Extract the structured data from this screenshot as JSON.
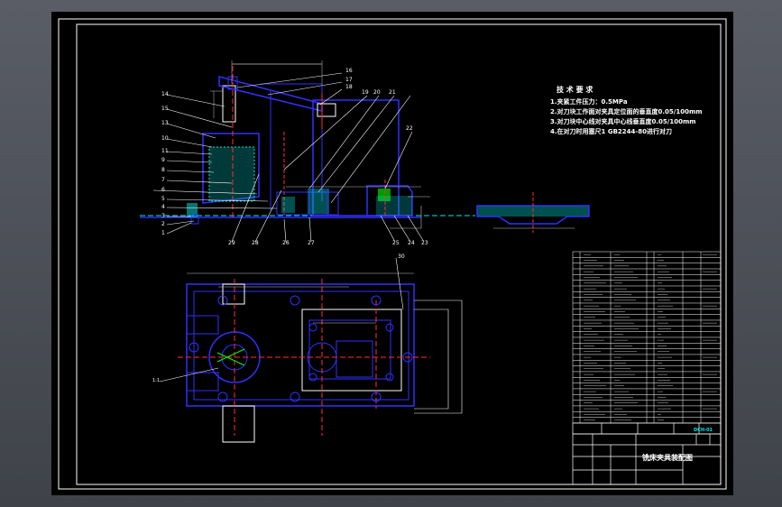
{
  "drawing": {
    "colors": {
      "background": "#000000",
      "outline": "#ffffff",
      "part": "#3030ff",
      "center": "#ff3030",
      "hatch": "#00e5e5",
      "dim": "#bfbfbf",
      "accent": "#ffff00",
      "green": "#00ff00"
    },
    "tech_title": "技 术 要 求",
    "tech_notes": [
      "1.夹紧工件压力：0.5MPa",
      "2.对刀块工作面对夹具定位面的垂直度0.05/100mm",
      "3.对刀块中心线对夹具中心线垂直度0.05/100mm",
      "4.在对刀时用塞尺1 GB2244-80进行对刀"
    ],
    "balloons_left": [
      "14",
      "15",
      "13",
      "10",
      "11",
      "9",
      "8",
      "7",
      "6",
      "5",
      "4",
      "3",
      "2",
      "1"
    ],
    "balloons_top": [
      "16",
      "17",
      "18",
      "19",
      "20",
      "21",
      "22"
    ],
    "balloons_bottom": [
      "29",
      "28",
      "26",
      "27",
      "25",
      "24",
      "23"
    ],
    "balloon_plan": "30",
    "plan_label": "1:1",
    "title_block": {
      "drawing_title": "铣床夹具装配图",
      "sheet_code": "DCH-01"
    }
  }
}
